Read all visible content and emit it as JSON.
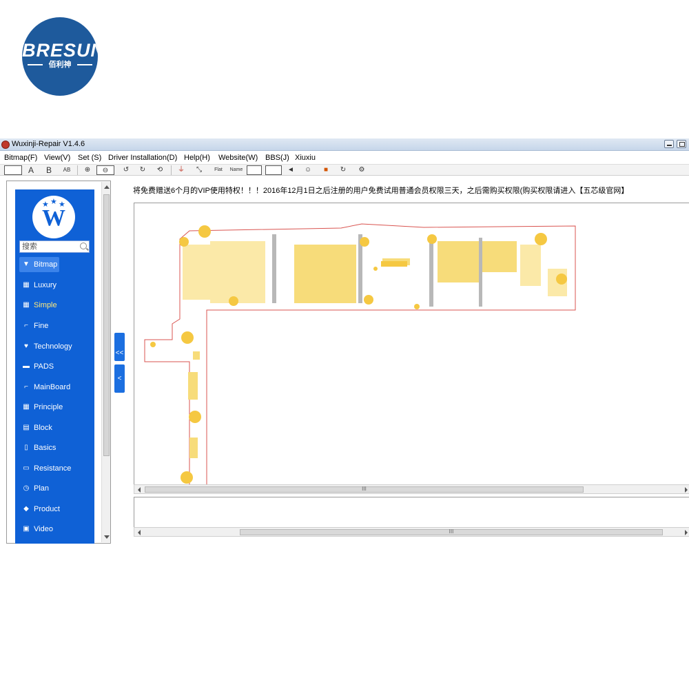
{
  "logo": {
    "text": "BRESUN",
    "subtitle": "佰利神",
    "color": "#1e5a9c"
  },
  "window": {
    "title": "Wuxinji-Repair V1.4.6"
  },
  "menu": [
    {
      "label": "Bitmap(F)"
    },
    {
      "label": "View(V)"
    },
    {
      "label": "Set (S)"
    },
    {
      "label": "Driver Installation(D)"
    },
    {
      "label": "Help(H)"
    },
    {
      "label": "Website(W)"
    },
    {
      "label": "BBS(J)"
    },
    {
      "label": "Xiuxiu"
    }
  ],
  "toolbar": {
    "a_label": "A",
    "b_label": "B",
    "ab_label": "AB",
    "flat_label": "Flat",
    "name_label": "Name"
  },
  "sidebar": {
    "accent": "#0f61d6",
    "search_placeholder": "搜索",
    "items": [
      {
        "label": "Bitmap",
        "icon": "triangle-down-icon",
        "active": true
      },
      {
        "label": "Luxury",
        "icon": "grid-icon"
      },
      {
        "label": "Simple",
        "icon": "grid-icon"
      },
      {
        "label": "Fine",
        "icon": "folder-icon"
      },
      {
        "label": "Technology",
        "icon": "heart-icon"
      },
      {
        "label": "PADS",
        "icon": "chat-icon"
      },
      {
        "label": "MainBoard",
        "icon": "folder-icon"
      },
      {
        "label": "Principle",
        "icon": "grid-icon"
      },
      {
        "label": "Block",
        "icon": "block-icon"
      },
      {
        "label": "Basics",
        "icon": "document-icon"
      },
      {
        "label": "Resistance",
        "icon": "resistor-icon"
      },
      {
        "label": "Plan",
        "icon": "clock-icon"
      },
      {
        "label": "Product",
        "icon": "cube-icon"
      },
      {
        "label": "Video",
        "icon": "video-icon"
      }
    ]
  },
  "collapse": {
    "all_label": "<<",
    "one_label": "<"
  },
  "notice": "将免费赠送6个月的VIP使用特权！！！2016年12月1日之后注册的用户免费试用普通会员权限三天，之后需购买权限(购买权限请进入【五芯级官网】",
  "statusbar": {
    "grip": "III"
  }
}
